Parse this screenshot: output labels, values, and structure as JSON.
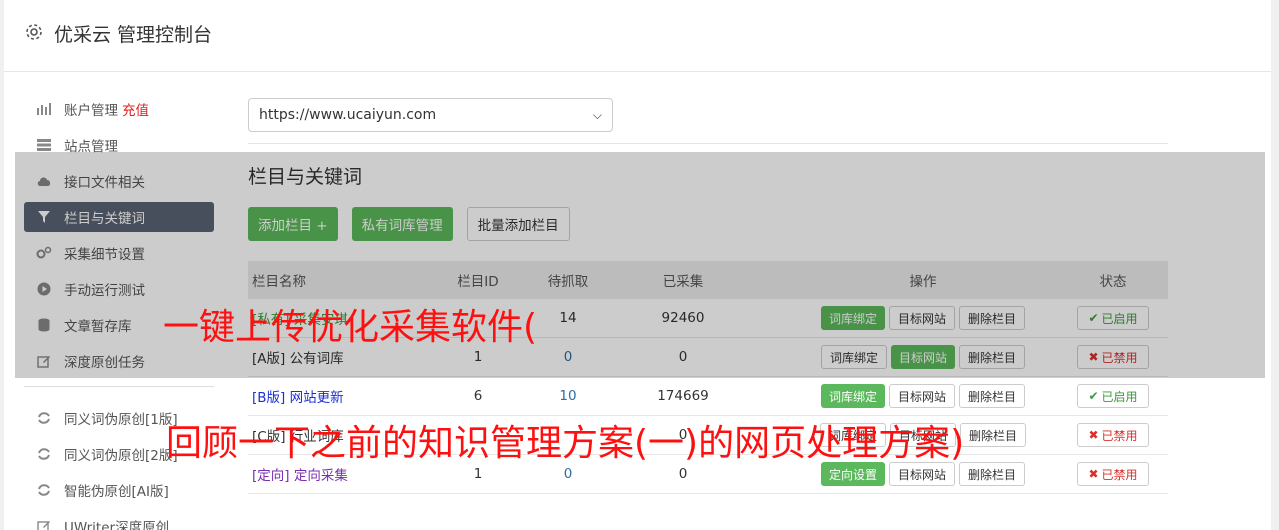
{
  "header": {
    "title": "优采云 管理控制台",
    "icon": "gear-icon"
  },
  "sidebar": {
    "items": [
      {
        "label": "账户管理",
        "extra": "充值",
        "icon": "bar-chart-icon"
      },
      {
        "label": "站点管理",
        "icon": "server-icon"
      },
      {
        "label": "接口文件相关",
        "icon": "cloud-upload-icon"
      },
      {
        "label": "栏目与关键词",
        "icon": "filter-icon",
        "active": true
      },
      {
        "label": "采集细节设置",
        "icon": "cogs-icon"
      },
      {
        "label": "手动运行测试",
        "icon": "play-circle-icon"
      },
      {
        "label": "文章暂存库",
        "icon": "database-icon"
      },
      {
        "label": "深度原创任务",
        "icon": "edit-icon"
      }
    ],
    "tools": [
      {
        "label": "同义词伪原创[1版]",
        "icon": "refresh-icon"
      },
      {
        "label": "同义词伪原创[2版]",
        "icon": "refresh-icon"
      },
      {
        "label": "智能伪原创[AI版]",
        "icon": "refresh-icon"
      },
      {
        "label": "UWriter深度原创",
        "icon": "edit-icon"
      }
    ]
  },
  "main": {
    "site_select": "https://www.ucaiyun.com",
    "section_title": "栏目与关键词",
    "buttons": {
      "add": "添加栏目 +",
      "private": "私有词库管理",
      "batch": "批量添加栏目"
    },
    "table": {
      "headers": {
        "name": "栏目名称",
        "id": "栏目ID",
        "pending": "待抓取",
        "done": "已采集",
        "ops": "操作",
        "status": "状态"
      },
      "rows": [
        {
          "tag": "[私有]",
          "name": "采集安琪",
          "id": "",
          "pending": "14",
          "done": "92460",
          "op1": "词库绑定",
          "op2": "目标网站",
          "op3": "删除栏目",
          "status": "已启用"
        },
        {
          "tag": "[A版]",
          "name": "公有词库",
          "id": "1",
          "pending": "0",
          "done": "0",
          "op1": "词库绑定",
          "op2": "目标网站",
          "op3": "删除栏目",
          "status": "已禁用"
        },
        {
          "tag": "[B版]",
          "name": "网站更新",
          "id": "6",
          "pending": "10",
          "done": "174669",
          "op1": "词库绑定",
          "op2": "目标网站",
          "op3": "删除栏目",
          "status": "已启用"
        },
        {
          "tag": "[C版]",
          "name": "行业词库",
          "id": "",
          "pending": "",
          "done": "0",
          "op1": "词库绑定",
          "op2": "目标网站",
          "op3": "删除栏目",
          "status": "已禁用"
        },
        {
          "tag": "[定向]",
          "name": "定向采集",
          "id": "1",
          "pending": "0",
          "done": "0",
          "op1": "定向设置",
          "op2": "目标网站",
          "op3": "删除栏目",
          "status": "已禁用"
        }
      ]
    }
  },
  "watermarks": {
    "line1": "一键上传优化采集软件(",
    "line2": "回顾一下之前的知识管理方案(一)的网页处理方案)"
  }
}
